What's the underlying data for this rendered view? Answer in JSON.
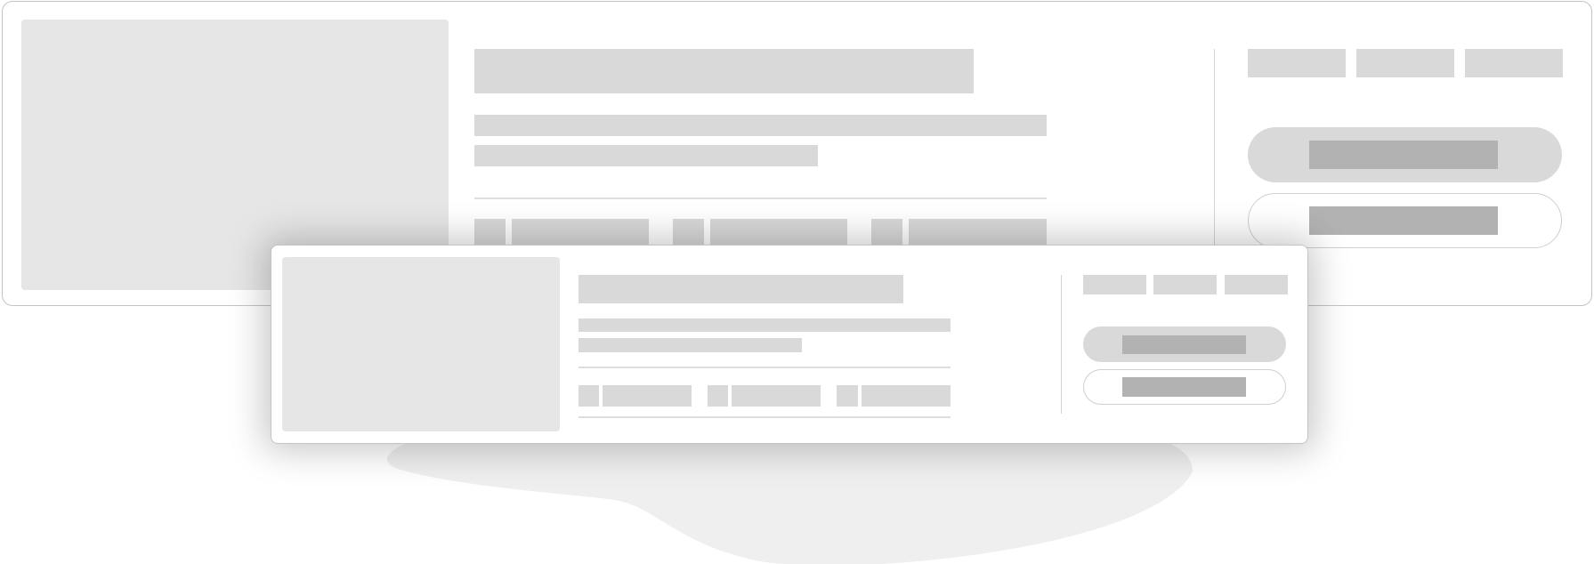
{
  "colors": {
    "card_border": "#c4c4c4",
    "placeholder_image": "#e6e6e6",
    "placeholder_text": "#d9d9d9",
    "button_label": "#b2b2b2",
    "divider": "#dedede",
    "backdrop_blob": "#efefef"
  },
  "cards": [
    {
      "role": "large wireframe card",
      "image_placeholder": true,
      "text_lines": 3,
      "meta_groups": 3,
      "tabs": 3,
      "buttons": [
        "filled",
        "outline"
      ]
    },
    {
      "role": "small wireframe card",
      "image_placeholder": true,
      "text_lines": 3,
      "meta_groups": 3,
      "tabs": 3,
      "buttons": [
        "filled",
        "outline"
      ]
    }
  ]
}
